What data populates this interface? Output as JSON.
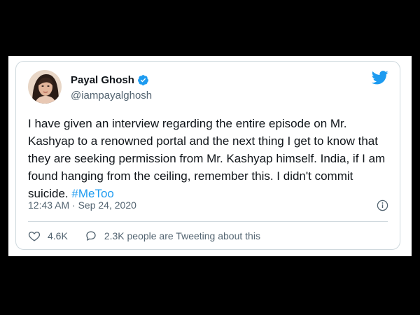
{
  "tweet": {
    "author": {
      "name": "Payal Ghosh",
      "handle": "@iampayalghosh",
      "verified": true
    },
    "body_text": "I have given an interview regarding the entire episode on Mr. Kashyap to a renowned portal and the next thing I get to know that they are seeking permission from Mr. Kashyap himself. India, if I am found hanging from the ceiling, remember this. I didn't commit suicide. ",
    "hashtag": "#MeToo",
    "timestamp": "12:43 AM · Sep 24, 2020",
    "likes": "4.6K",
    "discussion": "2.3K people are Tweeting about this"
  },
  "icons": {
    "brand": "twitter-bird-icon",
    "verified": "verified-badge-icon",
    "info": "info-icon",
    "like": "heart-icon",
    "reply": "speech-bubble-icon"
  },
  "colors": {
    "accent": "#1d9bf0",
    "text": "#0f1419",
    "muted": "#536471",
    "border": "#cfd9de",
    "background": "#000000"
  }
}
